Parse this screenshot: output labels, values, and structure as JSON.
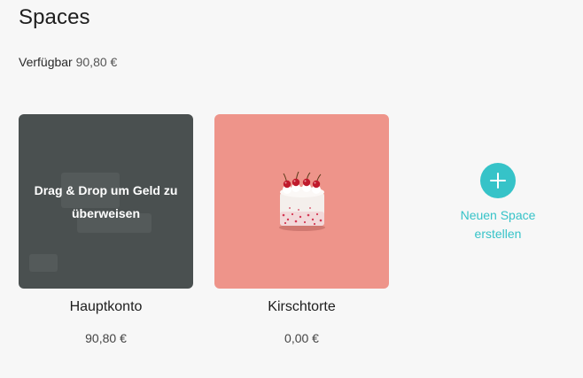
{
  "header": {
    "title": "Spaces"
  },
  "summary": {
    "label": "Verfügbar",
    "amount": "90,80 €"
  },
  "spaces": [
    {
      "name": "Hauptkonto",
      "balance": "90,80 €",
      "overlay": "Drag & Drop um Geld zu überweisen"
    },
    {
      "name": "Kirschtorte",
      "balance": "0,00 €",
      "image": "cherry-cake"
    }
  ],
  "new_space": {
    "label": "Neuen Space\nerstellen",
    "icon": "plus-icon"
  },
  "colors": {
    "accent": "#36c3c8",
    "main_card": "#4a5050",
    "cake_card": "#ee948a",
    "background": "#f7f7f7"
  }
}
